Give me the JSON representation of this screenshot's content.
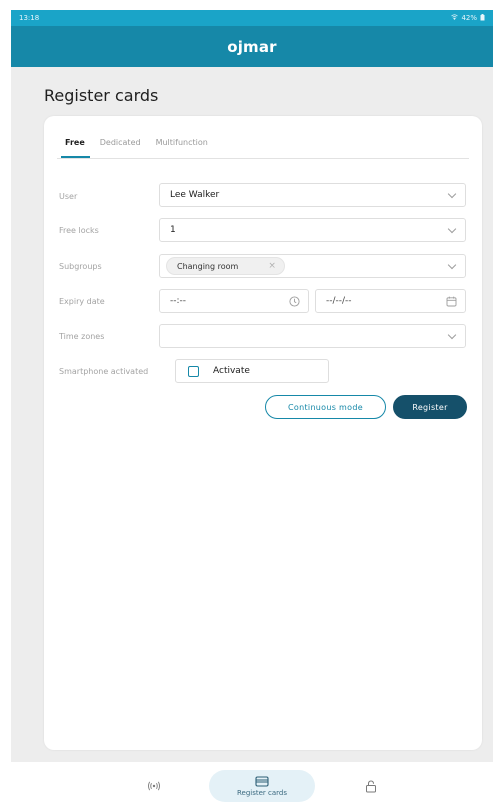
{
  "status_bar": {
    "time": "13:18",
    "indicators": "42%"
  },
  "app_bar": {
    "logo": "ojmar"
  },
  "page": {
    "title": "Register cards"
  },
  "tabs": [
    {
      "label": "Free",
      "active": true
    },
    {
      "label": "Dedicated",
      "active": false
    },
    {
      "label": "Multifunction",
      "active": false
    }
  ],
  "form": {
    "user": {
      "label": "User",
      "value": "Lee Walker"
    },
    "free_locks": {
      "label": "Free locks",
      "value": "1"
    },
    "subgroups": {
      "label": "Subgroups",
      "chip": "Changing room",
      "chip_remove": "×"
    },
    "expiry_date": {
      "label": "Expiry date",
      "time_value": "--:--",
      "date_value": "--/--/--"
    },
    "time_zones": {
      "label": "Time zones",
      "value": ""
    },
    "smartphone": {
      "label": "Smartphone activated",
      "checkbox_label": "Activate",
      "checked": false
    }
  },
  "buttons": {
    "continuous": "Continuous mode",
    "register": "Register"
  },
  "bottom_nav": {
    "items": [
      {
        "icon": "nfc-signal-icon",
        "label": ""
      },
      {
        "icon": "card-icon",
        "label": "Register cards",
        "active": true
      },
      {
        "icon": "lock-icon",
        "label": ""
      }
    ]
  },
  "colors": {
    "status_bar": "#1aa4c8",
    "app_bar": "#1688a8",
    "primary_button": "#15506a"
  }
}
